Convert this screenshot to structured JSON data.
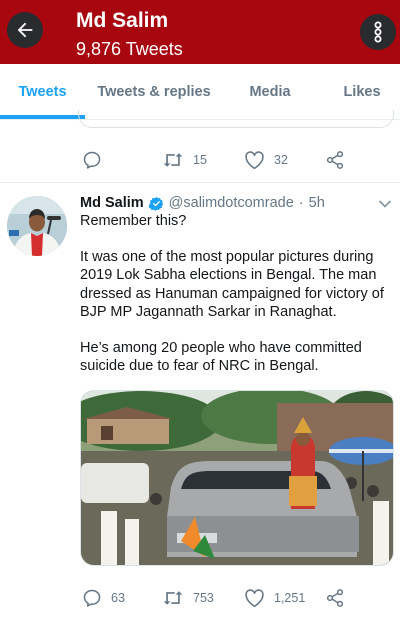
{
  "header": {
    "title": "Md Salim",
    "subtitle": "9,876 Tweets",
    "back_icon": "arrow-left-icon",
    "menu_icon": "more-vertical-icon",
    "bar_color": "#a8070f"
  },
  "tabs": [
    {
      "label": "Tweets",
      "active": true
    },
    {
      "label": "Tweets & replies",
      "active": false
    },
    {
      "label": "Media",
      "active": false
    },
    {
      "label": "Likes",
      "active": false
    }
  ],
  "accent_color": "#1da1f2",
  "previous_tweet": {
    "actions": {
      "reply_count": "",
      "retweet_count": "15",
      "like_count": "32"
    }
  },
  "tweet": {
    "author_name": "Md Salim",
    "handle": "@salimdotcomrade",
    "separator": "·",
    "time": "5h",
    "verified": true,
    "paragraphs": [
      "Remember this?",
      "It was one of the most popular pictures during 2019 Lok Sabha elections in Bengal. The man dressed as Hanuman campaigned for victory of BJP MP Jagannath Sarkar in Ranaghat.",
      "He’s among 20 people who have committed suicide due to fear of NRC in Bengal."
    ],
    "actions": {
      "reply_count": "63",
      "retweet_count": "753",
      "like_count": "1,251"
    }
  }
}
